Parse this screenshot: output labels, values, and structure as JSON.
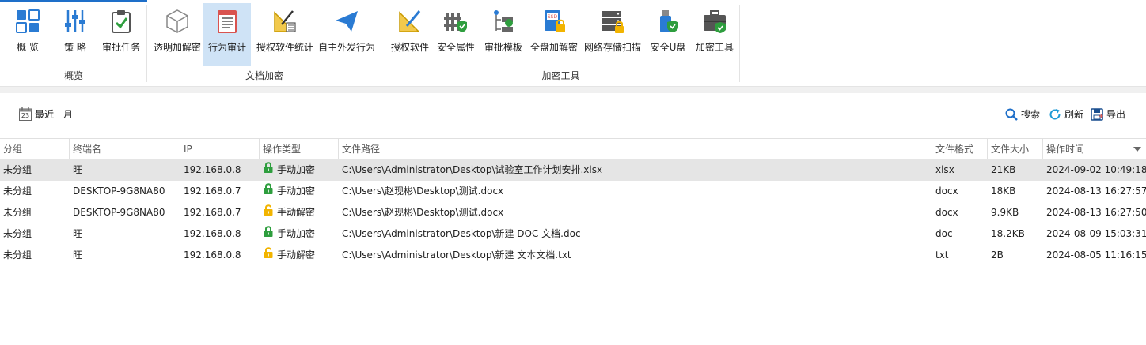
{
  "ribbon": {
    "groups": [
      {
        "label": "概览",
        "buttons": [
          {
            "label": "概 览",
            "icon": "overview-grid-icon"
          },
          {
            "label": "策 略",
            "icon": "policy-sliders-icon"
          },
          {
            "label": "审批任务",
            "icon": "approval-task-icon"
          }
        ]
      },
      {
        "label": "文档加密",
        "buttons": [
          {
            "label": "透明加解密",
            "icon": "transparent-encrypt-cube-icon"
          },
          {
            "label": "行为审计",
            "icon": "behavior-audit-icon"
          },
          {
            "label": "授权软件统计",
            "icon": "auth-software-stats-icon"
          },
          {
            "label": "自主外发行为",
            "icon": "outbound-send-icon"
          }
        ]
      },
      {
        "label": "加密工具",
        "buttons": [
          {
            "label": "授权软件",
            "icon": "auth-software-icon"
          },
          {
            "label": "安全属性",
            "icon": "security-attribute-icon"
          },
          {
            "label": "审批模板",
            "icon": "approval-template-icon"
          },
          {
            "label": "全盘加解密",
            "icon": "full-disk-encrypt-icon"
          },
          {
            "label": "网络存储扫描",
            "icon": "network-storage-scan-icon"
          },
          {
            "label": "安全U盘",
            "icon": "secure-usb-icon"
          },
          {
            "label": "加密工具",
            "icon": "encrypt-toolbox-icon"
          }
        ]
      }
    ]
  },
  "toolbar": {
    "date_range": "最近一月",
    "calendar_day": "23",
    "search": "搜索",
    "refresh": "刷新",
    "export": "导出"
  },
  "table": {
    "columns": [
      "分组",
      "终端名",
      "IP",
      "操作类型",
      "文件路径",
      "文件格式",
      "文件大小",
      "操作时间"
    ],
    "rows": [
      {
        "group": "未分组",
        "terminal": "旺",
        "ip": "192.168.0.8",
        "op": "手动加密",
        "op_lock": "green",
        "path": "C:\\Users\\Administrator\\Desktop\\试验室工作计划安排.xlsx",
        "format": "xlsx",
        "size": "21KB",
        "time": "2024-09-02 10:49:18"
      },
      {
        "group": "未分组",
        "terminal": "DESKTOP-9G8NA80",
        "ip": "192.168.0.7",
        "op": "手动加密",
        "op_lock": "green",
        "path": "C:\\Users\\赵现彬\\Desktop\\测试.docx",
        "format": "docx",
        "size": "18KB",
        "time": "2024-08-13 16:27:57"
      },
      {
        "group": "未分组",
        "terminal": "DESKTOP-9G8NA80",
        "ip": "192.168.0.7",
        "op": "手动解密",
        "op_lock": "yellow",
        "path": "C:\\Users\\赵现彬\\Desktop\\测试.docx",
        "format": "docx",
        "size": "9.9KB",
        "time": "2024-08-13 16:27:50"
      },
      {
        "group": "未分组",
        "terminal": "旺",
        "ip": "192.168.0.8",
        "op": "手动加密",
        "op_lock": "green",
        "path": "C:\\Users\\Administrator\\Desktop\\新建 DOC 文档.doc",
        "format": "doc",
        "size": "18.2KB",
        "time": "2024-08-09 15:03:31"
      },
      {
        "group": "未分组",
        "terminal": "旺",
        "ip": "192.168.0.8",
        "op": "手动解密",
        "op_lock": "yellow",
        "path": "C:\\Users\\Administrator\\Desktop\\新建 文本文档.txt",
        "format": "txt",
        "size": "2B",
        "time": "2024-08-05 11:16:15"
      }
    ]
  },
  "colors": {
    "accent": "#1e6fc9",
    "active_button": "#cfe3f6",
    "lock_green": "#2e9e3e",
    "lock_yellow": "#f2b400",
    "selected_row": "#e5e5e5"
  }
}
